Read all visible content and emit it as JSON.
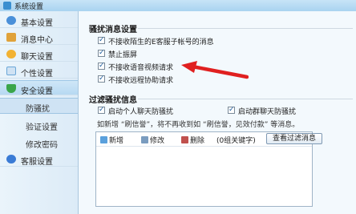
{
  "window": {
    "title": "系统设置"
  },
  "sidebar": {
    "items": [
      {
        "label": "基本设置",
        "icon": "settings-icon",
        "color": "#4a90d9"
      },
      {
        "label": "消息中心",
        "icon": "mail-icon",
        "color": "#e0a23a"
      },
      {
        "label": "聊天设置",
        "icon": "chat-icon",
        "color": "#f2b233"
      },
      {
        "label": "个性设置",
        "icon": "profile-icon",
        "color": "#6aa7d8"
      },
      {
        "label": "安全设置",
        "icon": "shield-icon",
        "color": "#3aa54a"
      },
      {
        "label": "客服设置",
        "icon": "service-icon",
        "color": "#3a7bd5"
      }
    ],
    "sub_items": [
      "防骚扰",
      "验证设置",
      "修改密码"
    ],
    "selected_sub": "防骚扰"
  },
  "harassment": {
    "title": "骚扰消息设置",
    "options": [
      {
        "label": "不接收陌生的E客服子帐号的消息",
        "checked": true
      },
      {
        "label": "禁止振屏",
        "checked": true
      },
      {
        "label": "不接收语音视频请求",
        "checked": true
      },
      {
        "label": "不接收远程协助请求",
        "checked": true
      }
    ]
  },
  "filter": {
    "title": "过滤骚扰信息",
    "personal_label": "启动个人聊天防骚扰",
    "personal_checked": true,
    "group_label": "启动群聊天防骚扰",
    "group_checked": true,
    "note": "如新增 “刷信誉”，将不再收到如 “刷信誉，见效付款” 等消息。",
    "toolbar": {
      "add": "新增",
      "edit": "修改",
      "delete": "删除",
      "count": "(0组关键字)"
    },
    "view_button": "查看过滤消息"
  },
  "annotation": {
    "arrow_color": "#e02020"
  }
}
